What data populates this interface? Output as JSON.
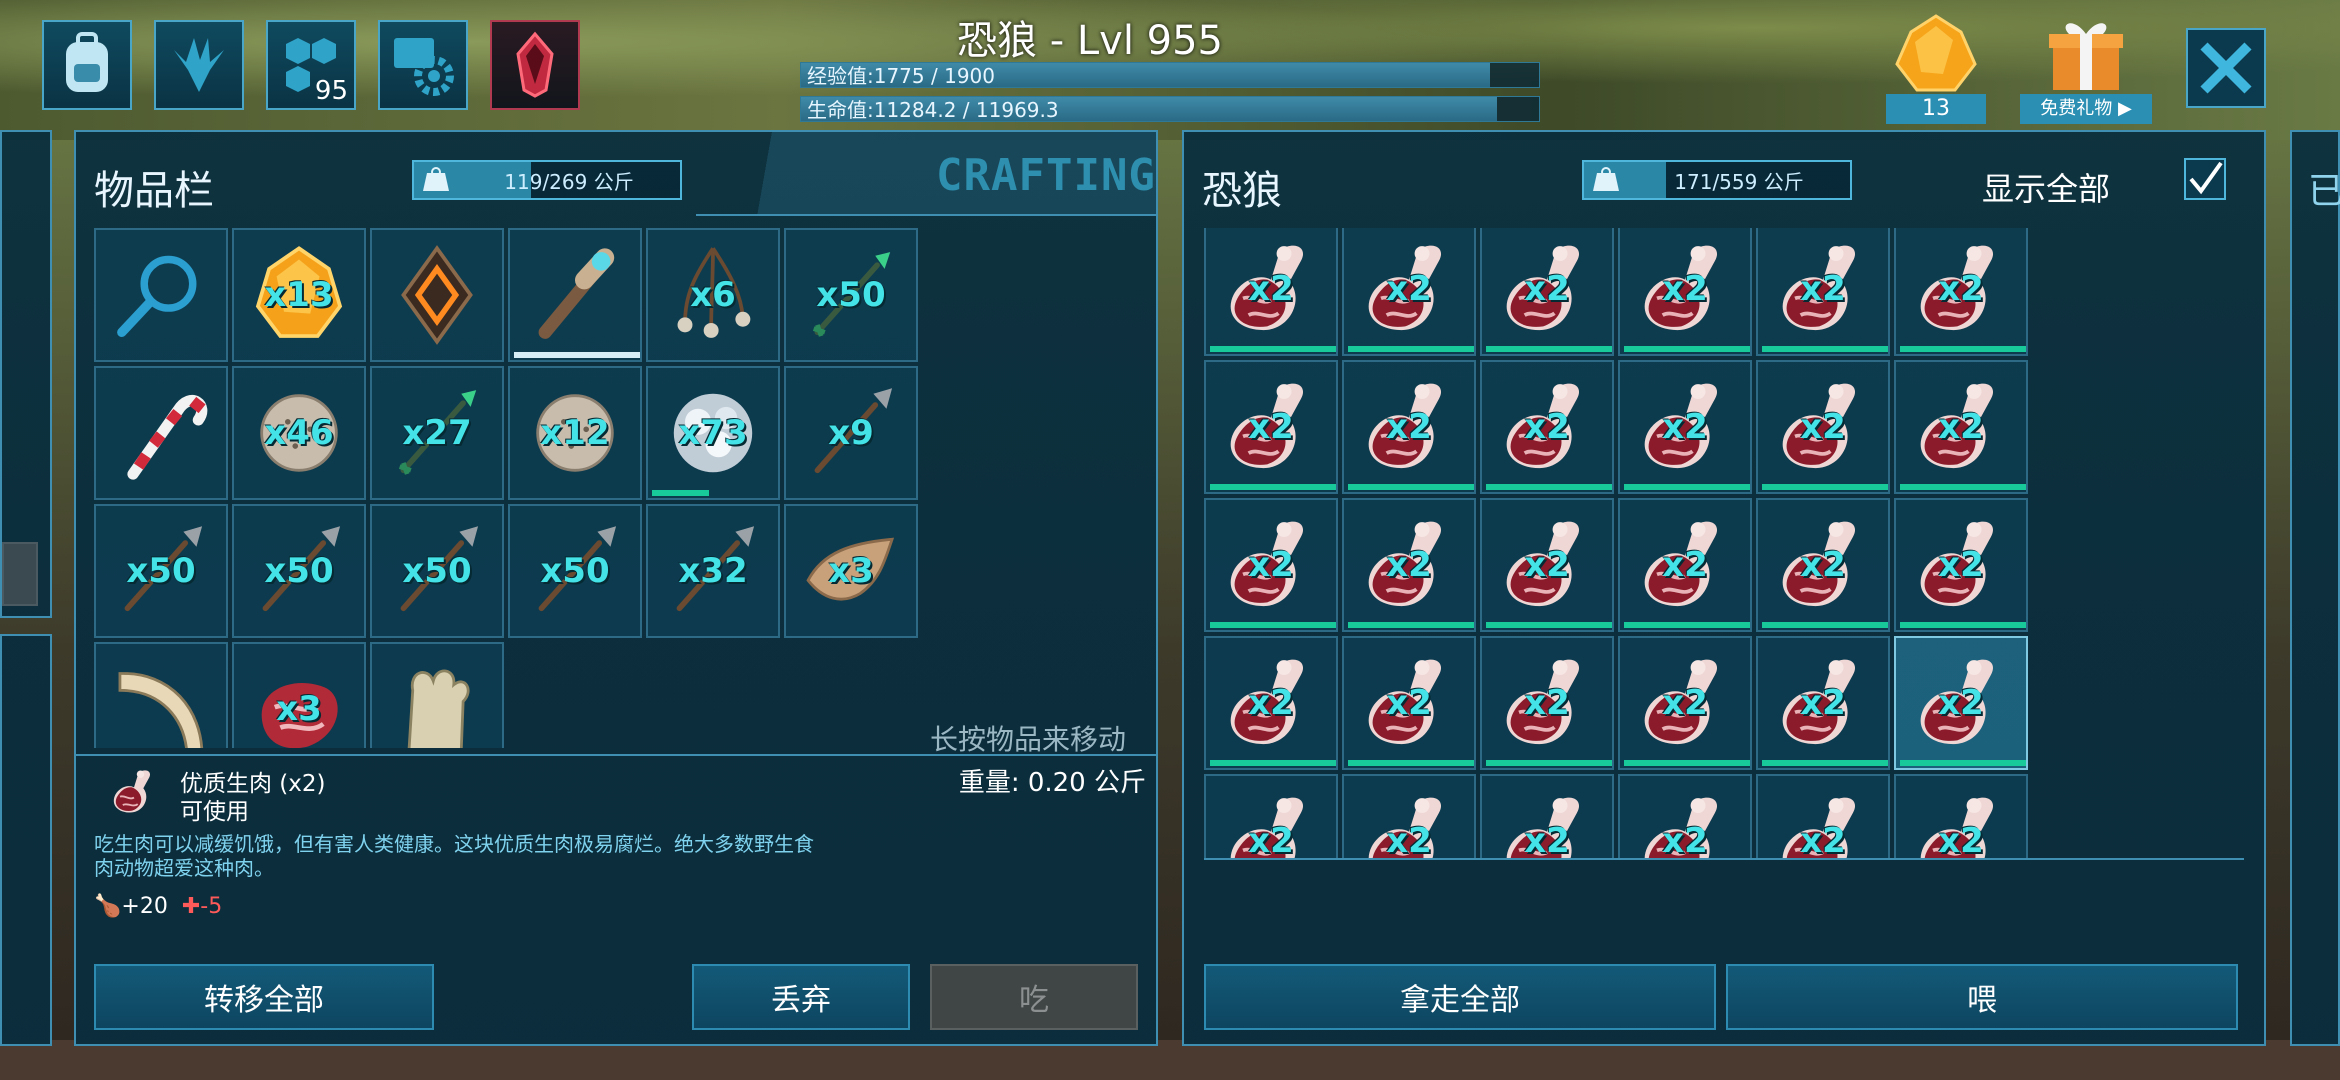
{
  "header": {
    "title": "恐狼 - Lvl 955",
    "xp": {
      "label": "经验值:1775 / 1900",
      "fraction": 0.934
    },
    "health": {
      "label": "生命值:11284.2 / 11969.3",
      "fraction": 0.943
    }
  },
  "top_icons": [
    "backpack-icon",
    "dino-footprint-icon",
    "engrams-icon",
    "settings-icon",
    "crystal-icon"
  ],
  "engram_badge": "95",
  "amber": {
    "count": "13"
  },
  "gift": {
    "label": "免费礼物"
  },
  "left_panel": {
    "title": "物品栏",
    "crafting_tab": "CRAFTING",
    "weight": "119/269 公斤",
    "weight_fraction": 0.44,
    "slots": [
      {
        "icon": "magnifier-icon",
        "qty": ""
      },
      {
        "icon": "amber-icon",
        "qty": "x13"
      },
      {
        "icon": "implant-icon",
        "qty": ""
      },
      {
        "icon": "torch-icon",
        "qty": "",
        "durability": 1.0
      },
      {
        "icon": "bola-icon",
        "qty": "x6"
      },
      {
        "icon": "arrow-icon",
        "qty": "x50"
      },
      {
        "icon": "candy-cane-icon",
        "qty": ""
      },
      {
        "icon": "stone-ball-icon",
        "qty": "x46"
      },
      {
        "icon": "arrow-icon",
        "qty": "x27"
      },
      {
        "icon": "stone-ball-icon",
        "qty": "x12"
      },
      {
        "icon": "pearl-cluster-icon",
        "qty": "x73",
        "durability": 0.45
      },
      {
        "icon": "spear-icon",
        "qty": "x9"
      },
      {
        "icon": "spear-icon",
        "qty": "x50"
      },
      {
        "icon": "spear-icon",
        "qty": "x50"
      },
      {
        "icon": "spear-icon",
        "qty": "x50"
      },
      {
        "icon": "spear-icon",
        "qty": "x50"
      },
      {
        "icon": "spear-icon",
        "qty": "x32"
      },
      {
        "icon": "hide-icon",
        "qty": "x3"
      },
      {
        "icon": "tusk-icon",
        "qty": ""
      },
      {
        "icon": "raw-meat-icon",
        "qty": "x3"
      },
      {
        "icon": "fungus-icon",
        "qty": ""
      }
    ],
    "hint": "长按物品来移动",
    "detail": {
      "name": "优质生肉 (x2)",
      "usable": "可使用",
      "weight": "重量: 0.20 公斤",
      "description": "吃生肉可以减缓饥饿，但有害人类健康。这块优质生肉极易腐烂。绝大多数野生食肉动物超爱这种肉。",
      "food_stat": "+20",
      "health_stat": "-5"
    },
    "buttons": {
      "transfer_all": "转移全部",
      "drop": "丢弃",
      "eat": "吃"
    }
  },
  "right_panel": {
    "title": "恐狼",
    "weight": "171/559 公斤",
    "weight_fraction": 0.31,
    "show_all": "显示全部",
    "show_all_checked": true,
    "slot_qty": "x2",
    "slot_rows": 5,
    "slot_cols": 6,
    "selected_index": 23,
    "buttons": {
      "take_all": "拿走全部",
      "feed": "喂"
    }
  },
  "colors": {
    "accent": "#3f8fb3",
    "qty": "#43e3e8",
    "durability": "#18c99a"
  }
}
